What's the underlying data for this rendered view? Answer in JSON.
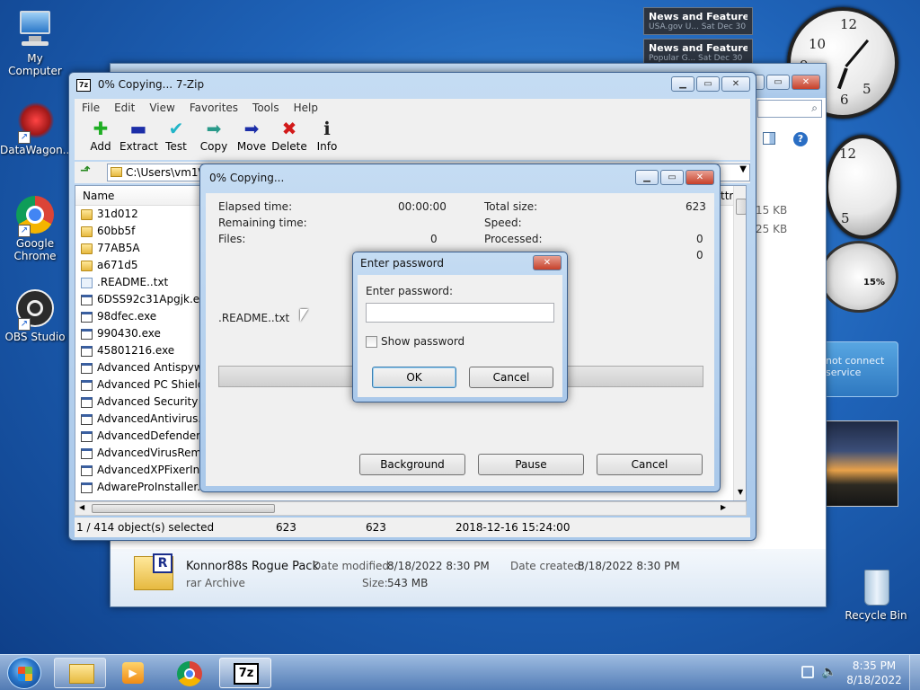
{
  "desktop": {
    "icons": [
      {
        "label": "My Computer"
      },
      {
        "label": "DataWagon..."
      },
      {
        "label": "Google Chrome"
      },
      {
        "label": "OBS Studio"
      },
      {
        "label": "Recycle Bin"
      }
    ]
  },
  "gadgets": {
    "feeds": [
      {
        "title": "News and Features f...",
        "source": "USA.gov U...",
        "date": "Sat Dec 30"
      },
      {
        "title": "News and Features f...",
        "source": "Popular G...",
        "date": "Sat Dec 30"
      }
    ],
    "meter_percent": "15%",
    "tile_text": "not connect service"
  },
  "explorer_bg": {
    "sizes": [
      "15 KB",
      "25 KB"
    ],
    "details": {
      "name": "Konnor88s Rogue Pack",
      "type": "rar Archive",
      "modified_label": "Date modified:",
      "modified": "8/18/2022 8:30 PM",
      "created_label": "Date created:",
      "created": "8/18/2022 8:30 PM",
      "size_label": "Size:",
      "size": "543 MB"
    }
  },
  "sevenzip": {
    "title": "0% Copying... 7-Zip",
    "app_icon": "7z",
    "menu": [
      "File",
      "Edit",
      "View",
      "Favorites",
      "Tools",
      "Help"
    ],
    "toolbar": [
      {
        "label": "Add",
        "icon": "plus-icon",
        "glyph": "✚",
        "color": "#1fae24"
      },
      {
        "label": "Extract",
        "icon": "minus-icon",
        "glyph": "▬",
        "color": "#1c2ea8"
      },
      {
        "label": "Test",
        "icon": "check-icon",
        "glyph": "✔",
        "color": "#22b5c8"
      },
      {
        "label": "Copy",
        "icon": "arrow-copy-icon",
        "glyph": "➡",
        "color": "#2a9a8a"
      },
      {
        "label": "Move",
        "icon": "arrow-move-icon",
        "glyph": "➡",
        "color": "#1c2ea8"
      },
      {
        "label": "Delete",
        "icon": "delete-x-icon",
        "glyph": "✖",
        "color": "#d21a1a"
      },
      {
        "label": "Info",
        "icon": "info-icon",
        "glyph": "ℹ",
        "color": "#222"
      }
    ],
    "address": "C:\\Users\\vm1\\D",
    "column_name": "Name",
    "column_attrib": "Attrib",
    "files": [
      {
        "name": "31d012",
        "kind": "folder"
      },
      {
        "name": "60bb5f",
        "kind": "folder"
      },
      {
        "name": "77AB5A",
        "kind": "folder"
      },
      {
        "name": "a671d5",
        "kind": "folder"
      },
      {
        "name": ".README..txt",
        "kind": "txt"
      },
      {
        "name": "6DSS92c31Apgjk.exe",
        "kind": "exe"
      },
      {
        "name": "98dfec.exe",
        "kind": "exe"
      },
      {
        "name": "990430.exe",
        "kind": "exe"
      },
      {
        "name": "45801216.exe",
        "kind": "exe"
      },
      {
        "name": "Advanced Antispywar",
        "kind": "exe"
      },
      {
        "name": "Advanced PC Shield 2",
        "kind": "exe"
      },
      {
        "name": "Advanced Security To",
        "kind": "exe"
      },
      {
        "name": "AdvancedAntivirus.exe",
        "kind": "exe"
      },
      {
        "name": "AdvancedDefenderIns",
        "kind": "exe"
      },
      {
        "name": "AdvancedVirusRemov",
        "kind": "exe"
      },
      {
        "name": "AdvancedXPFixerInsta",
        "kind": "exe"
      },
      {
        "name": "AdwareProInstaller.exe",
        "kind": "exe"
      }
    ],
    "status": {
      "selected": "1 / 414 object(s) selected",
      "size1": "623",
      "size2": "623",
      "date": "2018-12-16 15:24:00"
    }
  },
  "copying": {
    "title": "0% Copying...",
    "elapsed_label": "Elapsed time:",
    "elapsed": "00:00:00",
    "remaining_label": "Remaining time:",
    "files_label": "Files:",
    "files": "0",
    "total_label": "Total size:",
    "total": "623",
    "speed_label": "Speed:",
    "processed_label": "Processed:",
    "processed": "0",
    "extra": "0",
    "current_file": ".README..txt",
    "progress": 0,
    "background_label": "Background",
    "pause_label": "Pause",
    "cancel_label": "Cancel"
  },
  "password": {
    "title": "Enter password",
    "prompt": "Enter password:",
    "value": "",
    "show_label": "Show password",
    "ok_label": "OK",
    "cancel_label": "Cancel"
  },
  "taskbar": {
    "time": "8:35 PM",
    "date": "8/18/2022",
    "sevenzip_label": "7z"
  }
}
